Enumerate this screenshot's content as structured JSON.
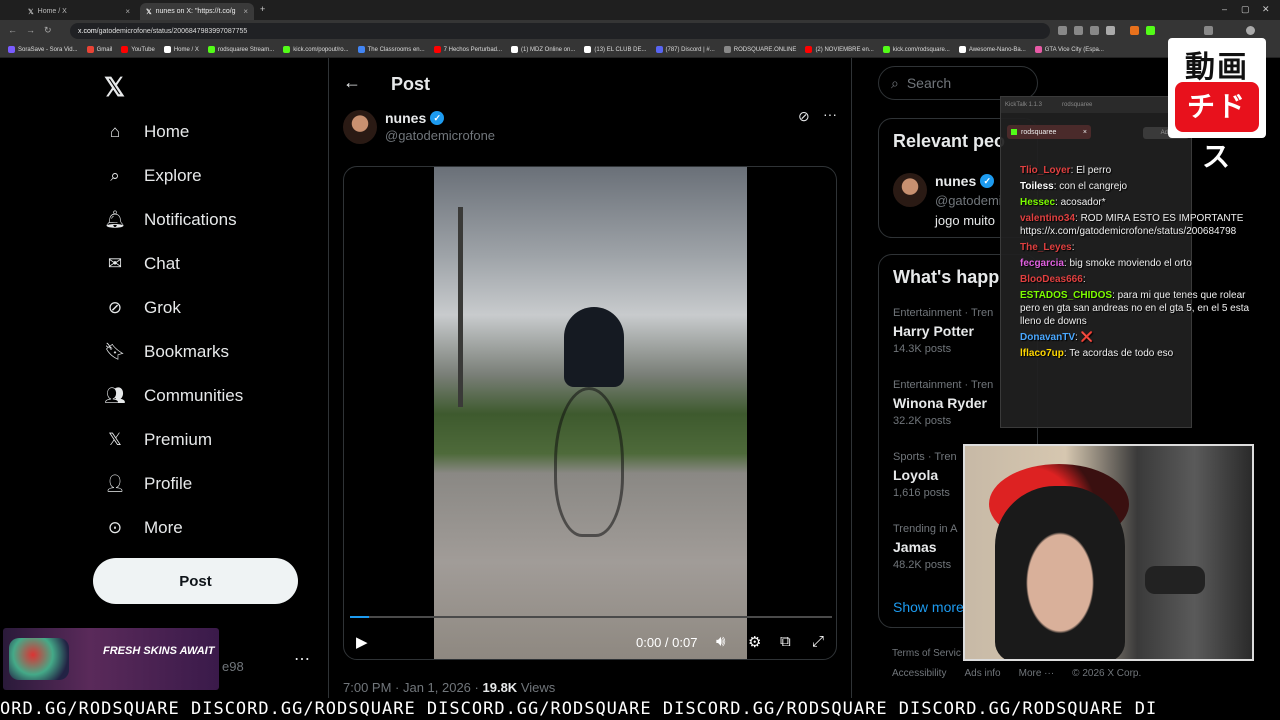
{
  "browser": {
    "tabs": [
      {
        "title": "Home / X",
        "close": "×"
      },
      {
        "title": "nunes on X: \"https://t.co/g",
        "close": "×"
      }
    ],
    "new_tab": "+",
    "url_domain": "x.com",
    "url_path": "/gatodemicrofone/status/2006847983997087755",
    "bookmarks": [
      {
        "label": "SoraSave - Sora Vid...",
        "color": "#7a5cff"
      },
      {
        "label": "Gmail",
        "color": "#ea4335"
      },
      {
        "label": "YouTube",
        "color": "#ff0000"
      },
      {
        "label": "Home / X",
        "color": "#ffffff"
      },
      {
        "label": "rodsquaree Stream...",
        "color": "#53fc18"
      },
      {
        "label": "kick.com/popout/ro...",
        "color": "#53fc18"
      },
      {
        "label": "The Classrooms en...",
        "color": "#4285f4"
      },
      {
        "label": "7 Hechos Perturbad...",
        "color": "#ff0000"
      },
      {
        "label": "(1) MDZ Online on...",
        "color": "#ffffff"
      },
      {
        "label": "(13) EL CLUB DE...",
        "color": "#ffffff"
      },
      {
        "label": "(787) Discord | #...",
        "color": "#5865f2"
      },
      {
        "label": "RODSQUARE.ONLINE",
        "color": "#888888"
      },
      {
        "label": "(2) NOVIEMBRE en...",
        "color": "#ff0000"
      },
      {
        "label": "kick.com/rodsquare...",
        "color": "#53fc18"
      },
      {
        "label": "Awesome-Nano-Ba...",
        "color": "#ffffff"
      },
      {
        "label": "GTA Vice City (Espa...",
        "color": "#e85aa6"
      }
    ]
  },
  "nav": {
    "items": [
      {
        "label": "Home",
        "icon": "home-icon"
      },
      {
        "label": "Explore",
        "icon": "search-icon"
      },
      {
        "label": "Notifications",
        "icon": "bell-icon"
      },
      {
        "label": "Chat",
        "icon": "mail-icon"
      },
      {
        "label": "Grok",
        "icon": "grok-icon"
      },
      {
        "label": "Bookmarks",
        "icon": "bookmark-icon"
      },
      {
        "label": "Communities",
        "icon": "people-icon"
      },
      {
        "label": "Premium",
        "icon": "x-icon"
      },
      {
        "label": "Profile",
        "icon": "person-icon"
      },
      {
        "label": "More",
        "icon": "more-circle-icon"
      }
    ],
    "post_button": "Post",
    "promo_text": "FRESH SKINS AWAIT",
    "account_suffix": "e98",
    "account_more": "⋯"
  },
  "post": {
    "header": "Post",
    "author_name": "nunes",
    "author_handle": "@gatodemicrofone",
    "video": {
      "time": "0:00 / 0:07",
      "progress": 0.04
    },
    "timestamp": "7:00 PM · Jan 1, 2026",
    "views_count": "19.8K",
    "views_label": "Views"
  },
  "sidebar": {
    "search_placeholder": "Search",
    "relevant_title": "Relevant peo",
    "relevant_name": "nunes",
    "relevant_handle": "@gatodemi",
    "relevant_bio": "jogo muito",
    "happening_title": "What's happ",
    "trends": [
      {
        "category": "Entertainment · Tren",
        "name": "Harry Potter",
        "count": "14.3K posts"
      },
      {
        "category": "Entertainment · Tren",
        "name": "Winona Ryder",
        "count": "32.2K posts"
      },
      {
        "category": "Sports · Tren",
        "name": "Loyola",
        "count": "1,616 posts"
      },
      {
        "category": "Trending in A",
        "name": "Jamas",
        "count": "48.2K posts"
      }
    ],
    "show_more": "Show more",
    "footer_line1": [
      "Terms of Servic"
    ],
    "footer_line2": [
      "Accessibility",
      "Ads info",
      "More ···",
      "© 2026 X Corp."
    ]
  },
  "chat": {
    "header": [
      "KickTalk 1.1.3",
      "rodsquaree"
    ],
    "tab_label": "rodsquaree",
    "add_label": "Add",
    "messages": [
      {
        "user": "Tlio_Loyer",
        "text": ": El perro",
        "color": "#e04040"
      },
      {
        "user": "Toiless",
        "text": ": con el cangrejo",
        "color": "#ffffff"
      },
      {
        "user": "Hessec",
        "text": ": acosador*",
        "color": "#7cfc00"
      },
      {
        "user": "valentino34",
        "text": ": ROD MIRA ESTO ES IMPORTANTE https://x.com/gatodemicrofone/status/200684798",
        "color": "#e04040"
      },
      {
        "user": "The_Leyes",
        "text": ":",
        "color": "#e04040"
      },
      {
        "user": "fecgarcia",
        "text": ": big smoke moviendo el orto",
        "color": "#e060e0"
      },
      {
        "user": "BlooDeas666",
        "text": ":",
        "color": "#e04040"
      },
      {
        "user": "ESTADOS_CHIDOS",
        "text": ": para mi que tenes que rolear pero en gta san andreas no en el gta 5, en el 5 esta lleno de downs",
        "color": "#7cfc00"
      },
      {
        "user": "DonavanTV",
        "text": ": ❌",
        "color": "#4aa8ff"
      },
      {
        "user": "lflaco7up",
        "text": ": Te acordas de todo eso",
        "color": "#ffd700"
      }
    ]
  },
  "logo": {
    "top": "動画",
    "bottom": "チドス"
  },
  "ticker": "ORD.GG/RODSQUARE DISCORD.GG/RODSQUARE DISCORD.GG/RODSQUARE DISCORD.GG/RODSQUARE DISCORD.GG/RODSQUARE DI"
}
